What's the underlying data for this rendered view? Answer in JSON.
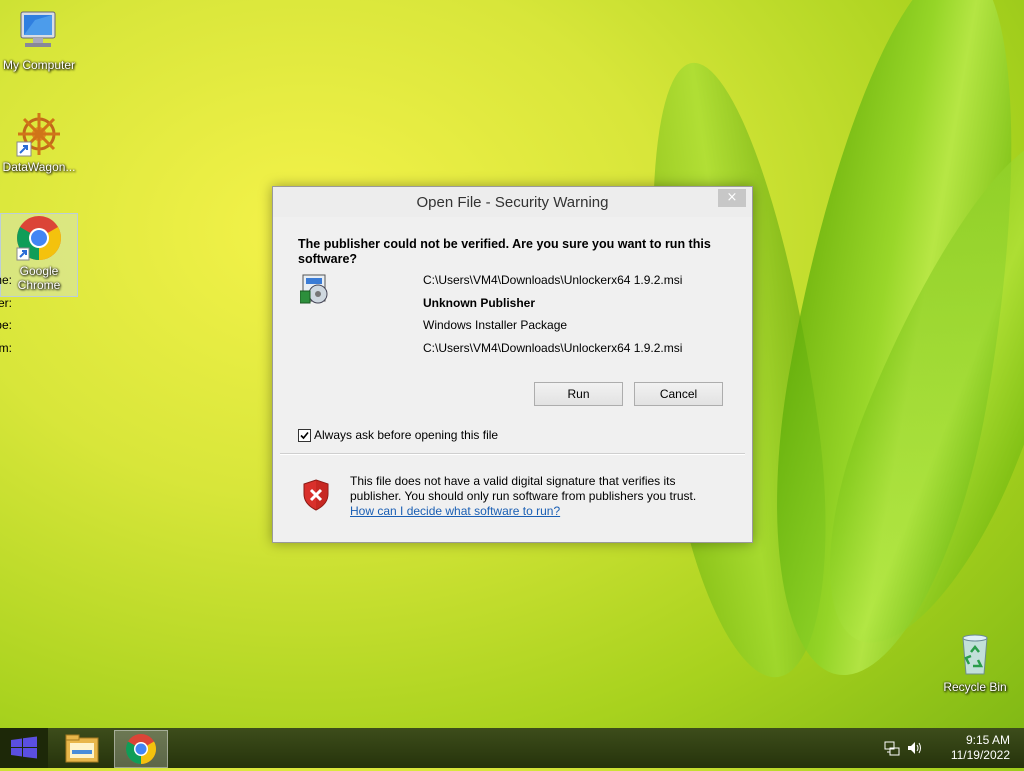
{
  "desktop": {
    "icons": [
      {
        "label": "My Computer"
      },
      {
        "label": "DataWagon..."
      },
      {
        "label": "Google Chrome"
      },
      {
        "label": "Recycle Bin"
      }
    ]
  },
  "dialog": {
    "title": "Open File - Security Warning",
    "close_label": "×",
    "question": "The publisher could not be verified.  Are you sure you want to run this software?",
    "fields": [
      {
        "label": "Name:",
        "value": "C:\\Users\\VM4\\Downloads\\Unlockerx64 1.9.2.msi",
        "bold": false
      },
      {
        "label": "Publisher:",
        "value": "Unknown Publisher",
        "bold": true
      },
      {
        "label": "Type:",
        "value": "Windows Installer Package",
        "bold": false
      },
      {
        "label": "From:",
        "value": "C:\\Users\\VM4\\Downloads\\Unlockerx64 1.9.2.msi",
        "bold": false
      }
    ],
    "run_label": "Run",
    "cancel_label": "Cancel",
    "checkbox_label": "Always ask before opening this file",
    "checkbox_checked": true,
    "warning_text": "This file does not have a valid digital signature that verifies its publisher.  You should only run software from publishers you trust.",
    "help_link": "How can I decide what software to run?"
  },
  "taskbar": {
    "time": "9:15 AM",
    "date": "11/19/2022"
  },
  "colors": {
    "taskbar": "#2c3c10",
    "link": "#1a5fb4",
    "shield_red": "#d9302b"
  }
}
